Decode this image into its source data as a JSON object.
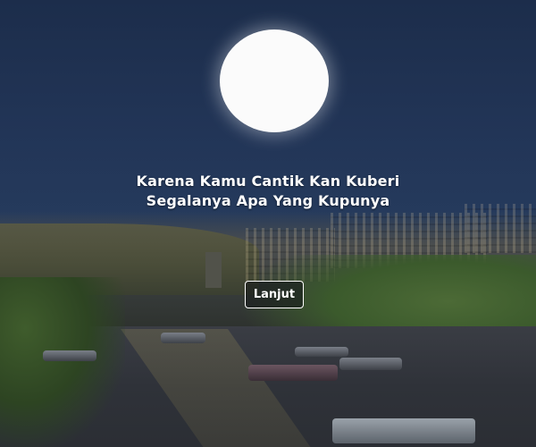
{
  "quote": {
    "line1": "Karena Kamu Cantik Kan Kuberi",
    "line2": "Segalanya Apa Yang Kupunya"
  },
  "next_button": {
    "label": "Lanjut"
  },
  "colors": {
    "text": "#ffffff",
    "moon": "#fbfbfb",
    "sky": "#1c2d4b"
  }
}
